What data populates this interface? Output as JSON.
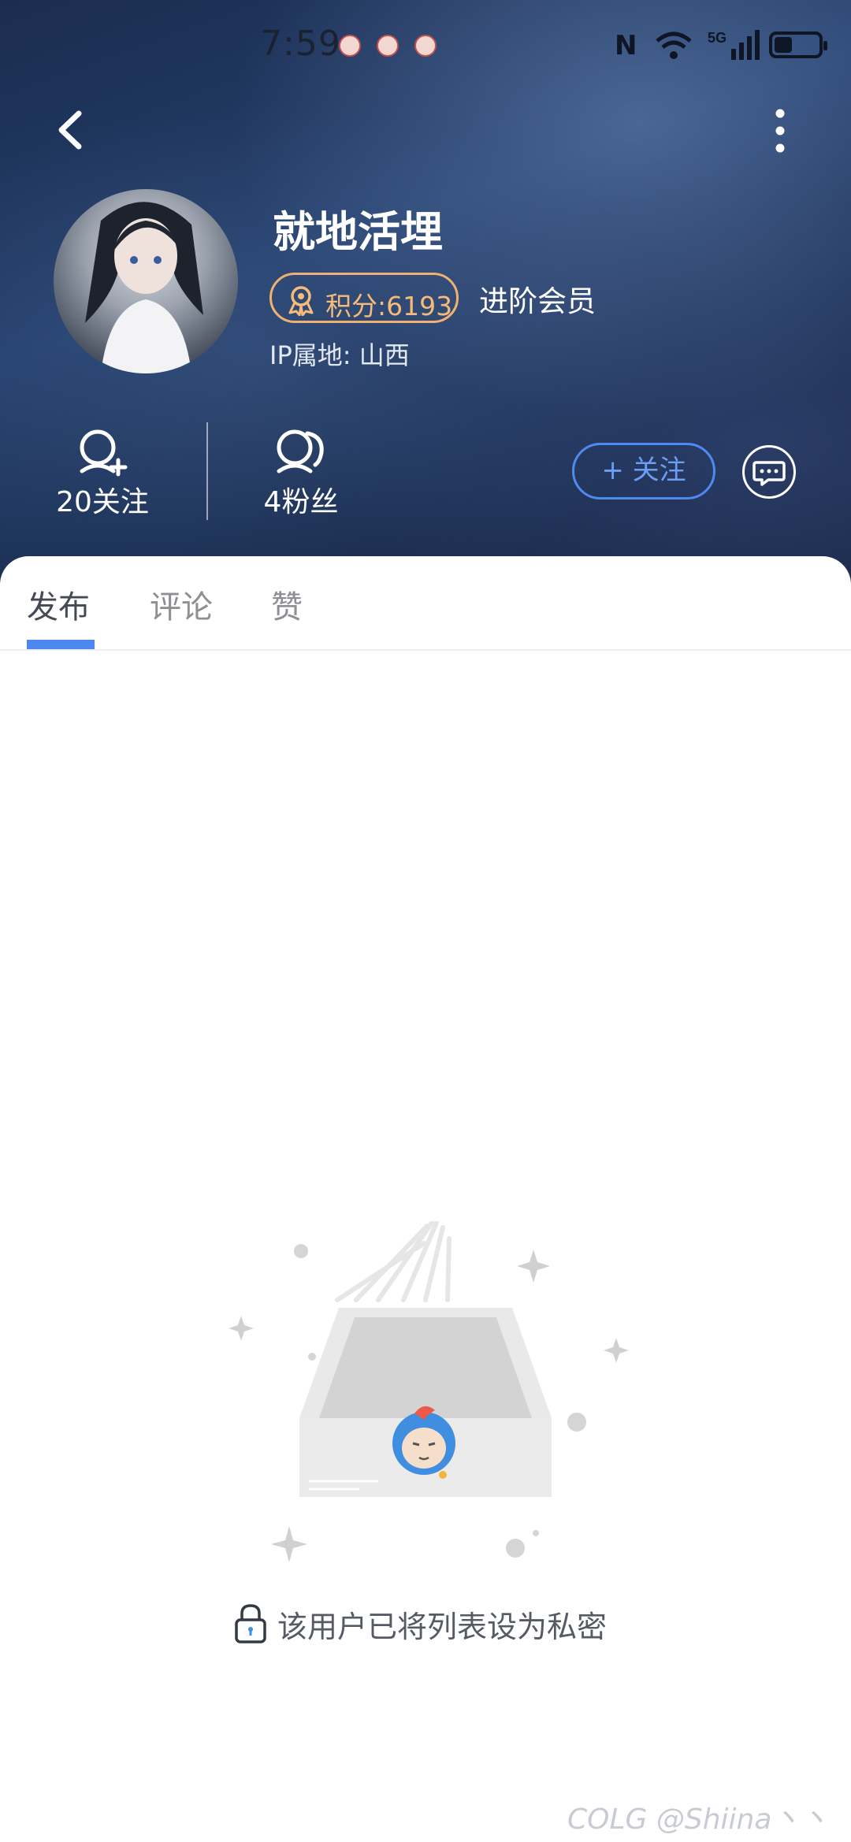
{
  "status_bar": {
    "time": "7:59",
    "notification_icons": [
      "app-notification-icon",
      "app-notification-icon",
      "app-notification-icon"
    ],
    "nfc": "N",
    "signal_label": "5G",
    "battery_level_fraction": 0.4
  },
  "profile": {
    "username": "就地活埋",
    "points_label": "积分:6193",
    "member_level": "进阶会员",
    "ip_location": "IP属地: 山西"
  },
  "stats": {
    "following_label": "20关注",
    "fans_label": "4粉丝"
  },
  "actions": {
    "follow_label": "+ 关注"
  },
  "tabs": [
    {
      "label": "发布",
      "active": true
    },
    {
      "label": "评论",
      "active": false
    },
    {
      "label": "赞",
      "active": false
    }
  ],
  "empty_state": {
    "message": "该用户已将列表设为私密"
  },
  "watermark": "COLG @Shiina丶丶",
  "colors": {
    "accent": "#4b87ee",
    "badge": "#f6bb78",
    "header_bg": "#1f355c"
  }
}
